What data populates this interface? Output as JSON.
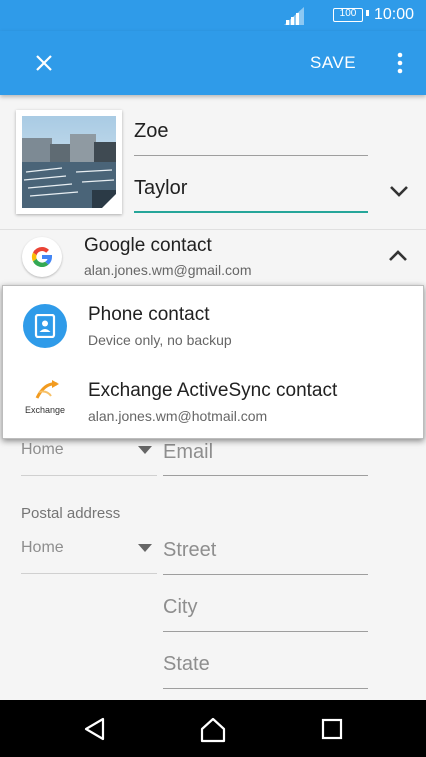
{
  "status": {
    "battery": "100",
    "time": "10:00"
  },
  "appbar": {
    "save_label": "SAVE"
  },
  "name": {
    "first": "Zoe",
    "last": "Taylor"
  },
  "account": {
    "title": "Google contact",
    "email": "alan.jones.wm@gmail.com"
  },
  "popup": {
    "items": [
      {
        "title": "Phone contact",
        "subtitle": "Device only, no backup"
      },
      {
        "title": "Exchange ActiveSync contact",
        "subtitle": "alan.jones.wm@hotmail.com"
      }
    ],
    "exchange_logo_text": "Exchange"
  },
  "email": {
    "type": "Home",
    "placeholder": "Email"
  },
  "postal": {
    "section_label": "Postal address",
    "type": "Home",
    "street_placeholder": "Street",
    "city_placeholder": "City",
    "state_placeholder": "State"
  },
  "colors": {
    "accent": "#2f9be9",
    "field_focus": "#26a69a"
  }
}
